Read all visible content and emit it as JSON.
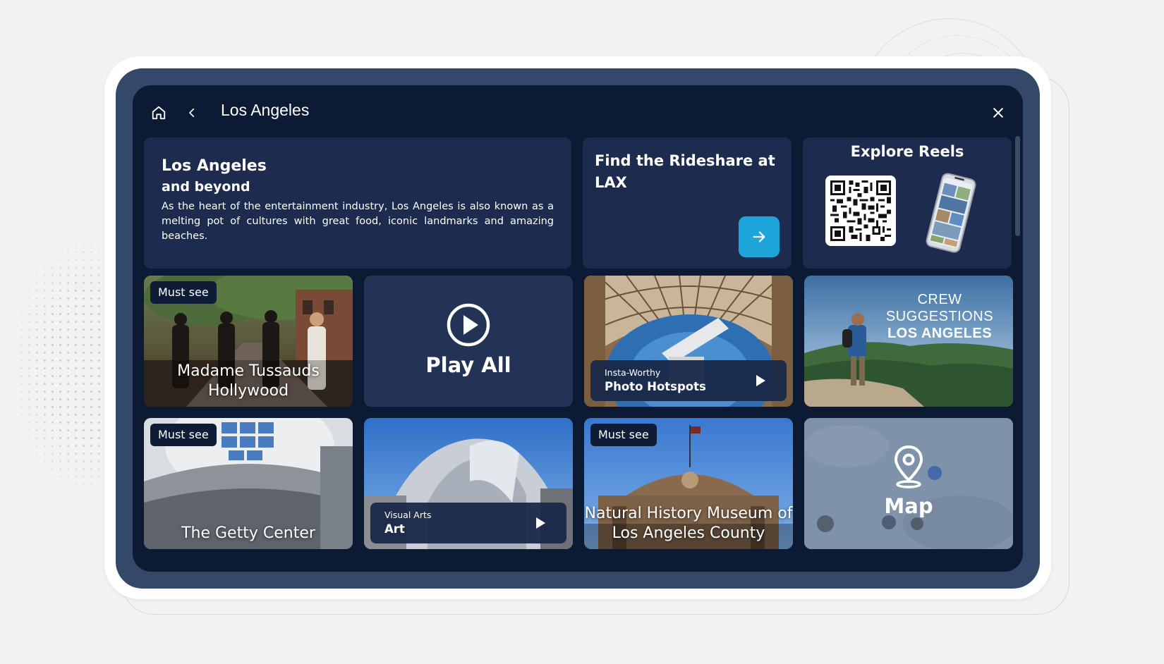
{
  "header": {
    "title": "Los Angeles",
    "home_icon": "home-icon",
    "back_icon": "chevron-left-icon",
    "close_icon": "close-icon"
  },
  "intro": {
    "title": "Los Angeles",
    "subtitle": "and beyond",
    "description": "As the heart of the entertainment industry, Los Angeles is also known as a melting pot of cultures with great food, iconic landmarks and amazing beaches."
  },
  "rideshare": {
    "title": "Find the Rideshare at LAX",
    "button_icon": "arrow-right-icon"
  },
  "reels": {
    "title": "Explore Reels",
    "qr_icon": "qr-code-icon",
    "phone_icon": "phone-preview-icon"
  },
  "tiles": [
    {
      "badge": "Must see",
      "caption": "Madame Tussauds Hollywood"
    },
    {
      "label": "Play All",
      "icon": "play-circle-icon"
    },
    {
      "small": "Insta-Worthy",
      "big": "Photo Hotspots"
    },
    {
      "line1": "CREW",
      "line2": "SUGGESTIONS",
      "line3": "LOS ANGELES"
    },
    {
      "badge": "Must see",
      "caption": "The Getty Center"
    },
    {
      "small": "Visual Arts",
      "big": "Art"
    },
    {
      "badge": "Must see",
      "caption": "Natural History Museum of Los Angeles County"
    },
    {
      "label": "Map",
      "icon": "map-pin-icon"
    }
  ],
  "colors": {
    "screen_bg": "#0c1a33",
    "card_bg": "#1d2c4e",
    "bezel": "#34486a",
    "accent": "#1ea5da"
  }
}
